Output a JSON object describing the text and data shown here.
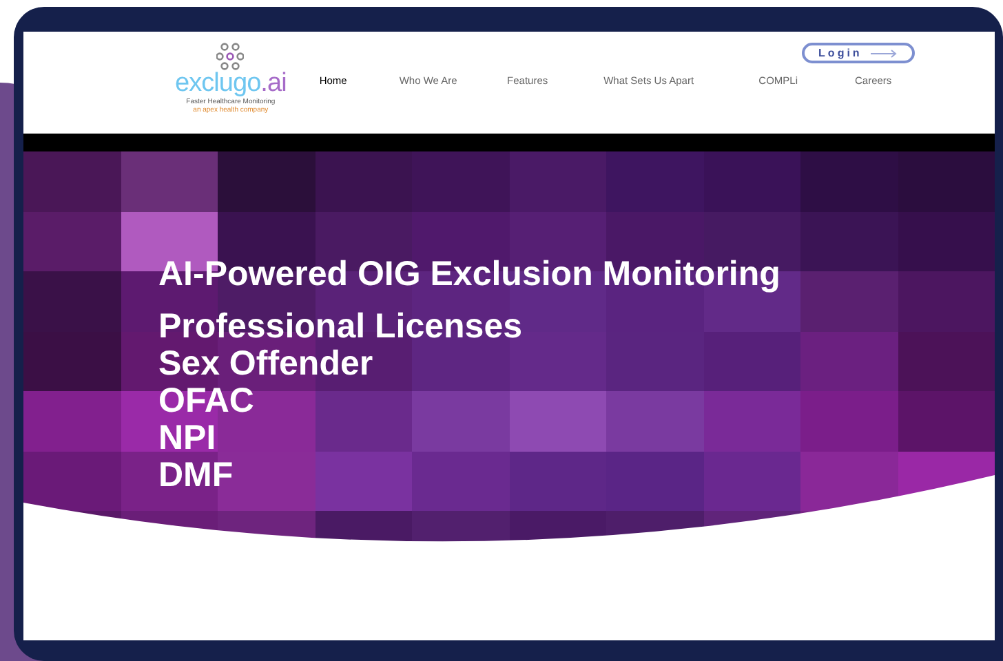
{
  "logo": {
    "wordmark": "exclugo",
    "suffix": ".ai",
    "tagline": "Faster Healthcare Monitoring",
    "company_line": "an apex health company"
  },
  "nav": [
    {
      "label": "Home",
      "selected": true
    },
    {
      "label": "Who We Are",
      "selected": false
    },
    {
      "label": "Features",
      "selected": false
    },
    {
      "label": "What Sets Us Apart",
      "selected": false
    },
    {
      "label": "COMPLi",
      "selected": false
    },
    {
      "label": "Careers",
      "selected": false
    }
  ],
  "login": {
    "label": "Login"
  },
  "hero": {
    "title": "AI-Powered OIG Exclusion Monitoring",
    "items": [
      "Professional Licenses",
      "Sex Offender",
      "OFAC",
      "NPI",
      "DMF"
    ]
  }
}
